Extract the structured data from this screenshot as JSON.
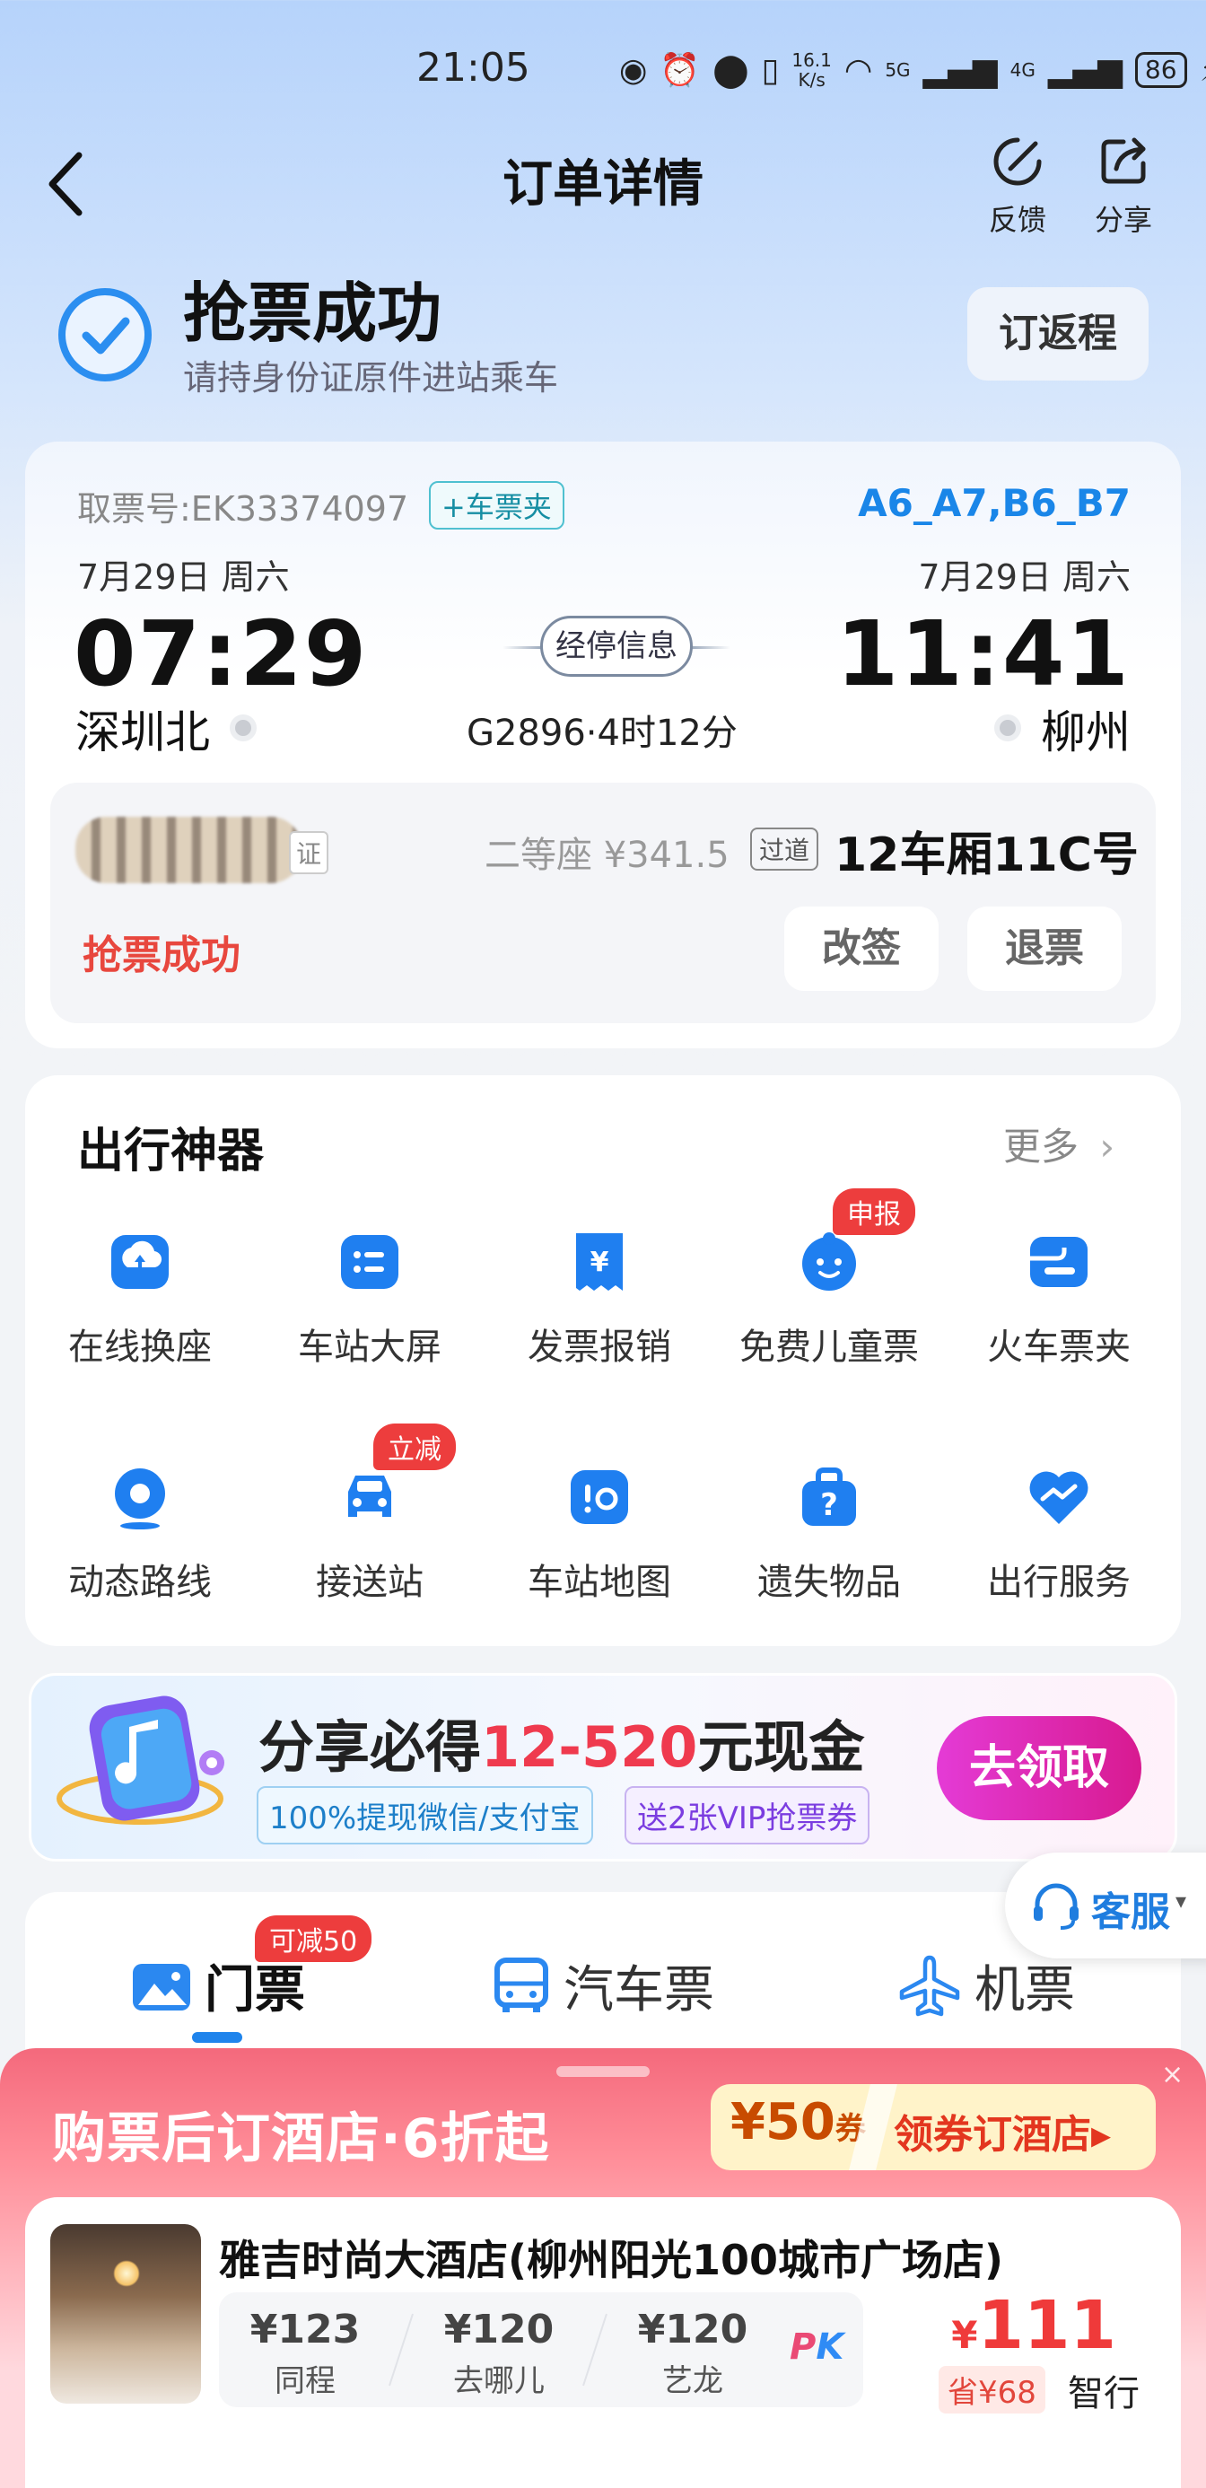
{
  "status_bar": {
    "time": "21:05",
    "speed_top": "16.1",
    "speed_bottom": "K/s",
    "sig1": "5G",
    "sig2": "4G",
    "battery": "86"
  },
  "header": {
    "title": "订单详情",
    "feedback": "反馈",
    "share": "分享"
  },
  "success": {
    "title": "抢票成功",
    "subtitle": "请持身份证原件进站乘车",
    "return_button": "订返程"
  },
  "ticket": {
    "ticket_no": "取票号:EK33374097",
    "folder_tag": "+车票夹",
    "seat_codes": "A6_A7,B6_B7",
    "dep_date": "7月29日  周六",
    "arr_date": "7月29日  周六",
    "dep_time": "07:29",
    "arr_time": "11:41",
    "stop_info": "经停信息",
    "dep_station": "深圳北",
    "arr_station": "柳州",
    "train": "G2896·4时12分"
  },
  "passenger": {
    "id_tag": "证",
    "seat_class": "二等座 ¥341.5",
    "aisle_tag": "过道",
    "seat_no": "12车厢11C号",
    "status": "抢票成功",
    "change_button": "改签",
    "refund_button": "退票"
  },
  "tools": {
    "title": "出行神器",
    "more": "更多",
    "items": [
      {
        "label": "在线换座",
        "icon": "seat-swap-icon"
      },
      {
        "label": "车站大屏",
        "icon": "station-screen-icon"
      },
      {
        "label": "发票报销",
        "icon": "invoice-icon"
      },
      {
        "label": "免费儿童票",
        "icon": "child-ticket-icon",
        "badge": "申报"
      },
      {
        "label": "火车票夹",
        "icon": "ticket-wallet-icon"
      },
      {
        "label": "动态路线",
        "icon": "route-icon"
      },
      {
        "label": "接送站",
        "icon": "car-icon",
        "badge": "立减"
      },
      {
        "label": "车站地图",
        "icon": "station-map-icon"
      },
      {
        "label": "遗失物品",
        "icon": "lost-item-icon"
      },
      {
        "label": "出行服务",
        "icon": "travel-service-icon"
      }
    ]
  },
  "banner": {
    "text_a": "分享必得",
    "text_hl": "12-520",
    "text_b": "元现金",
    "chip1": "100%提现微信/支付宝",
    "chip2": "送2张VIP抢票券",
    "button": "去领取"
  },
  "service": {
    "label": "客服"
  },
  "tabs": {
    "items": [
      {
        "label": "门票",
        "badge": "可减50"
      },
      {
        "label": "汽车票"
      },
      {
        "label": "机票"
      }
    ]
  },
  "hotel_promo": {
    "close": "×",
    "title": "购票后订酒店·6折起",
    "coupon_amount": "¥50",
    "coupon_unit": "券",
    "coupon_text": "领券订酒店▸",
    "hotel_name": "雅吉时尚大酒店(柳州阳光100城市广场店)",
    "compare": [
      {
        "price": "¥123",
        "name": "同程"
      },
      {
        "price": "¥120",
        "name": "去哪儿"
      },
      {
        "price": "¥120",
        "name": "艺龙"
      }
    ],
    "pk_a": "P",
    "pk_b": "K",
    "price_symbol": "¥",
    "price": "111",
    "save": "省¥68",
    "brand": "智行"
  },
  "colors": {
    "accent": "#1a86e8",
    "success_red": "#e8473e",
    "promo_pink": "#f4697c",
    "cta_magenta": "#d81a90"
  }
}
